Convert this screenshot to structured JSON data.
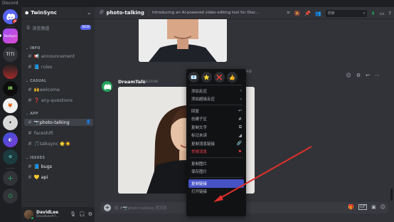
{
  "window": {
    "app_name": "Discord"
  },
  "rail": {
    "servers": [
      {
        "label": "",
        "badge": "9"
      },
      {
        "label": "TwinSync",
        "badge": ""
      },
      {
        "label": "T(T)",
        "badge": ""
      },
      {
        "label": "",
        "badge": ""
      },
      {
        "label": "IR",
        "badge": ""
      },
      {
        "label": "",
        "badge": ""
      },
      {
        "label": "",
        "badge": ""
      },
      {
        "label": "",
        "badge": ""
      },
      {
        "label": "",
        "badge": ""
      }
    ],
    "add_label": "+",
    "discover_label": "⊙"
  },
  "sidebar": {
    "server_name": "TwinSync",
    "browse_label": "浏览频道",
    "browse_badge": "NEW",
    "categories": [
      {
        "name": "INFO",
        "channels": [
          {
            "emoji": "📢",
            "name": "announcement"
          },
          {
            "emoji": "📘",
            "name": "rules"
          }
        ]
      },
      {
        "name": "CASUAL",
        "channels": [
          {
            "emoji": "🙌",
            "name": "welcome"
          },
          {
            "emoji": "❓",
            "name": "any-questions"
          }
        ]
      },
      {
        "name": "APP",
        "channels": [
          {
            "emoji": "📷",
            "name": "photo-talking"
          },
          {
            "emoji": "",
            "name": "faceshift"
          },
          {
            "emoji": "🎵",
            "name": "talksync 🌟☀️"
          }
        ]
      },
      {
        "name": "ISSUES",
        "channels": [
          {
            "emoji": "📘",
            "name": "bugs"
          },
          {
            "emoji": "💛",
            "name": "api"
          }
        ]
      }
    ]
  },
  "user": {
    "name": "DavidLee",
    "tag": "DavidLee#7..."
  },
  "main": {
    "channel": "photo-talking",
    "topic": "Introducing an AI-powered video editing tool for Disc...",
    "search_placeholder": "搜索",
    "message": {
      "author": "DreamTale",
      "time": "昨天19:08",
      "time_right": "今日"
    },
    "composer_placeholder": "给 #📷photo-talking 发消息"
  },
  "context_menu": {
    "reactions": [
      "📧",
      "⭐",
      "❌",
      "👍"
    ],
    "items": [
      {
        "label": "添加反应",
        "icon": "›",
        "style": ""
      },
      {
        "label": "添加超级反应",
        "icon": "›",
        "style": ""
      },
      {
        "sep": true
      },
      {
        "label": "回复",
        "icon": "↩",
        "style": ""
      },
      {
        "label": "创建子区",
        "icon": "#",
        "style": ""
      },
      {
        "label": "复制文字",
        "icon": "⧉",
        "style": ""
      },
      {
        "label": "标记未读",
        "icon": "◢",
        "style": ""
      },
      {
        "label": "复制消息链接",
        "icon": "🔗",
        "style": ""
      },
      {
        "label": "举报消息",
        "icon": "⚑",
        "style": "danger"
      },
      {
        "sep": true
      },
      {
        "label": "复制图片",
        "icon": "",
        "style": ""
      },
      {
        "label": "保存图片",
        "icon": "",
        "style": ""
      },
      {
        "sep": true
      },
      {
        "label": "复制链接",
        "icon": "",
        "style": "hl"
      },
      {
        "label": "打开链接",
        "icon": "",
        "style": ""
      }
    ]
  },
  "colors": {
    "accent": "#5865f2",
    "highlight": "#4752c4",
    "danger": "#f23f43",
    "online": "#23a55a",
    "arrow": "#e0302b"
  }
}
